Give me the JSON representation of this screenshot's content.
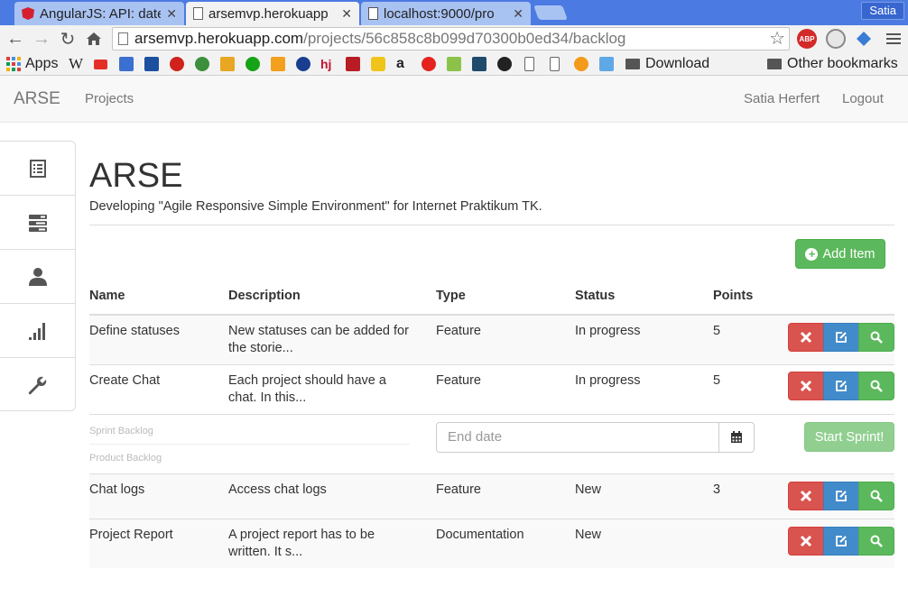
{
  "browser": {
    "tabs": [
      {
        "title": "AngularJS: API: date",
        "state": "inactive"
      },
      {
        "title": "arsemvp.herokuapp",
        "state": "active"
      },
      {
        "title": "localhost:9000/pro",
        "state": "inactive"
      }
    ],
    "profile": "Satia",
    "url": {
      "host": "arsemvp.herokuapp.com",
      "path": "/projects/56c858c8b099d70300b0ed34/backlog"
    },
    "bookmarks": {
      "apps": "Apps",
      "download_folder": "Download",
      "other": "Other bookmarks"
    },
    "extensions": {
      "abp": "ABP"
    }
  },
  "navbar": {
    "brand": "ARSE",
    "projects": "Projects",
    "user": "Satia Herfert",
    "logout": "Logout"
  },
  "sidebar": {
    "icons": [
      "list-icon",
      "tasks-icon",
      "user-icon",
      "stats-icon",
      "wrench-icon"
    ]
  },
  "page": {
    "title": "ARSE",
    "subtitle": "Developing \"Agile Responsive Simple Environment\" for Internet Praktikum TK.",
    "add_item": "Add Item"
  },
  "table": {
    "headers": {
      "name": "Name",
      "description": "Description",
      "type": "Type",
      "status": "Status",
      "points": "Points"
    },
    "rows": [
      {
        "name": "Define statuses",
        "description": "New statuses can be added for the storie...",
        "type": "Feature",
        "status": "In progress",
        "points": "5"
      },
      {
        "name": "Create Chat",
        "description": "Each project should have a chat. In this...",
        "type": "Feature",
        "status": "In progress",
        "points": "5"
      },
      {
        "name": "Chat logs",
        "description": "Access chat logs",
        "type": "Feature",
        "status": "New",
        "points": "3"
      },
      {
        "name": "Project Report",
        "description": "A project report has to be written. It s...",
        "type": "Documentation",
        "status": "New",
        "points": ""
      }
    ]
  },
  "sprint": {
    "sprint_backlog": "Sprint Backlog",
    "product_backlog": "Product Backlog",
    "end_date_placeholder": "End date",
    "start_button": "Start Sprint!"
  },
  "colors": {
    "success": "#5cb85c",
    "danger": "#d9534f",
    "primary": "#428bca",
    "tabstrip": "#4b7ae2"
  }
}
